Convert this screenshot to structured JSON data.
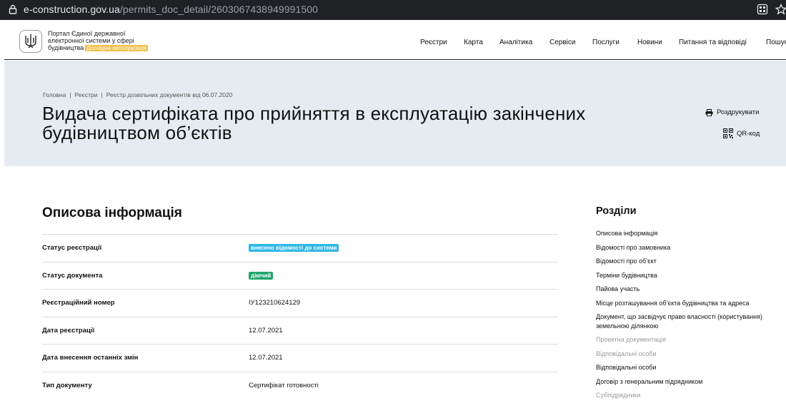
{
  "browser": {
    "url_domain": "e-construction.gov.ua",
    "url_path": "/permits_doc_detail/2603067438949991500"
  },
  "header": {
    "portal_title": "Портал Єдиної державної електронної системи у сфері будівництва",
    "beta_label": "Дослідна експлуатація",
    "nav": [
      {
        "label": "Реєстри"
      },
      {
        "label": "Карта"
      },
      {
        "label": "Аналітика"
      },
      {
        "label": "Сервіси"
      },
      {
        "label": "Послуги"
      },
      {
        "label": "Новини"
      },
      {
        "label": "Питання та відповіді"
      },
      {
        "label": "Пошук"
      }
    ]
  },
  "hero": {
    "breadcrumb": [
      "Головна",
      "Реєстри",
      "Реєстр дозвільних документів від 06.07.2020"
    ],
    "title": "Видача сертифіката про прийняття в експлуатацію закінчених будівництвом об’єктів",
    "print_label": "Роздрукувати",
    "qr_label": "QR-код"
  },
  "main": {
    "section_title": "Описова інформація",
    "rows": [
      {
        "label": "Статус реєстрації",
        "value": "внесено відомості до системи",
        "badge": "blue"
      },
      {
        "label": "Статус документа",
        "value": "діючий",
        "badge": "green"
      },
      {
        "label": "Реєстраційний номер",
        "value": "ІУ123210624129"
      },
      {
        "label": "Дата реєстрації",
        "value": "12.07.2021"
      },
      {
        "label": "Дата внесення останніх змін",
        "value": "12.07.2021"
      },
      {
        "label": "Тип документу",
        "value": "Сертифікат готовності"
      }
    ]
  },
  "sidebar": {
    "title": "Розділи",
    "items": [
      {
        "label": "Описова інформація",
        "enabled": true
      },
      {
        "label": "Відомості про замовника",
        "enabled": true
      },
      {
        "label": "Відомості про об’єкт",
        "enabled": true
      },
      {
        "label": "Терміни будівництва",
        "enabled": true
      },
      {
        "label": "Пайова участь",
        "enabled": true
      },
      {
        "label": "Місце розташування об’єкта будівництва та адреса",
        "enabled": true
      },
      {
        "label": "Документ, що засвідчує право власності (користування) земельною ділянкою",
        "enabled": true
      },
      {
        "label": "Проектна документація",
        "enabled": false
      },
      {
        "label": "Відповідальні особи",
        "enabled": false
      },
      {
        "label": "Відповідальні особи",
        "enabled": true
      },
      {
        "label": "Договір з генеральним підрядником",
        "enabled": true
      },
      {
        "label": "Субпідрядники",
        "enabled": false
      }
    ]
  },
  "colors": {
    "hero_bg": "#e5ebf0",
    "badge_blue": "#2eb7e6",
    "badge_green": "#1ea56a",
    "beta_badge": "#f0c04a"
  }
}
